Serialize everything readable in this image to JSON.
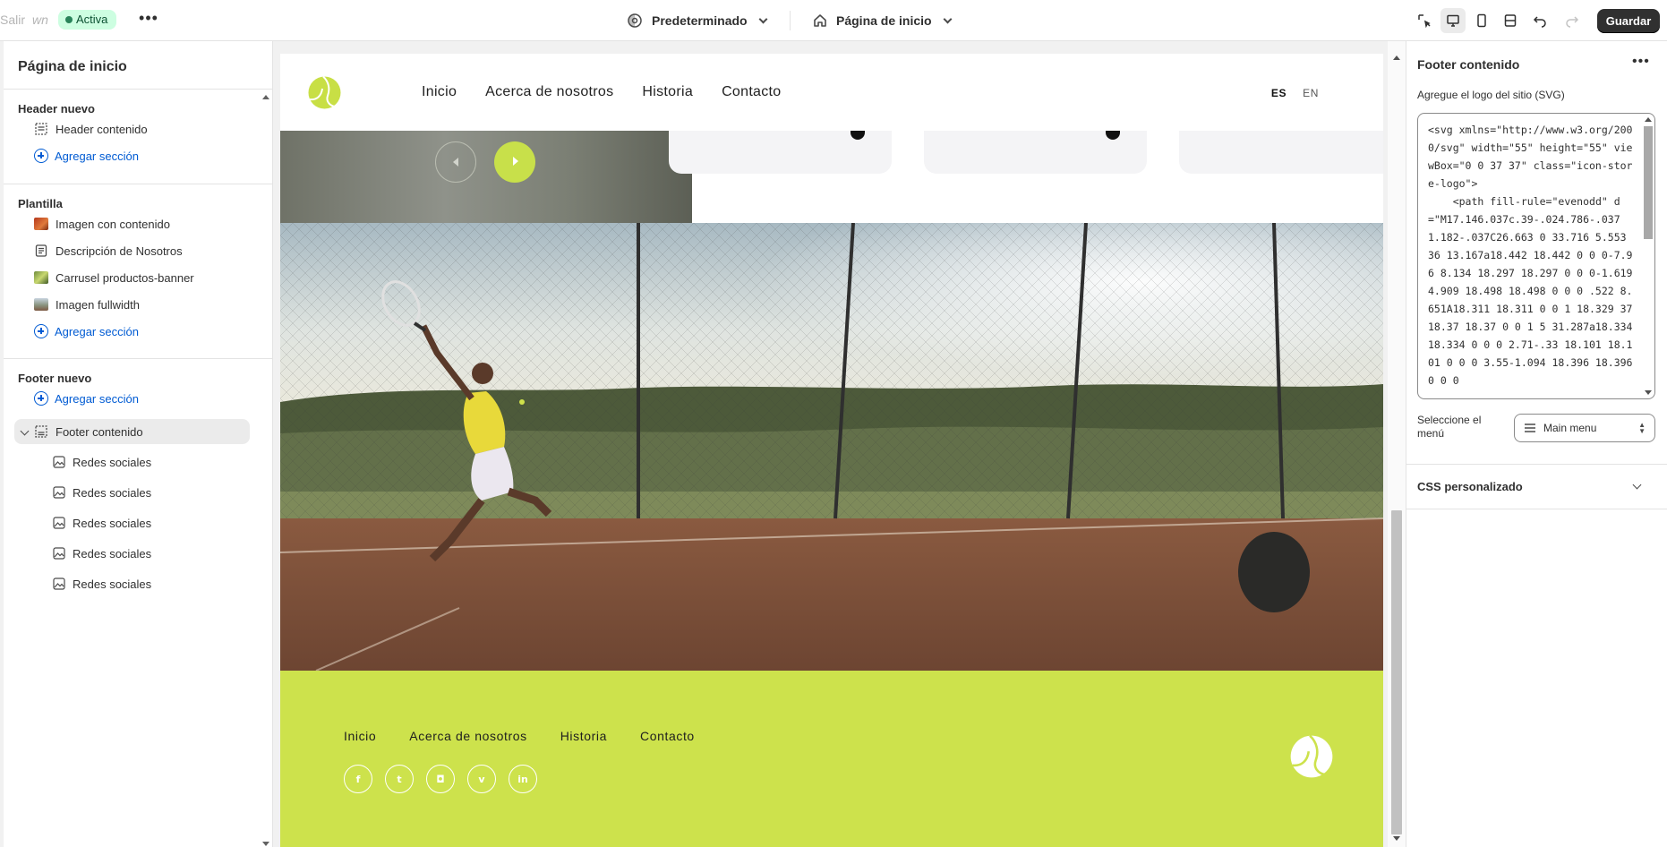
{
  "topbar": {
    "exit_label": "Salir",
    "store_name": "wn",
    "status_badge": "Activa",
    "theme_selector": "Predeterminado",
    "page_selector": "Página de inicio",
    "save_label": "Guardar"
  },
  "sidebar": {
    "title": "Página de inicio",
    "header_group": {
      "label": "Header nuevo",
      "items": [
        {
          "label": "Header contenido",
          "icon": "layout-icon"
        }
      ],
      "add_label": "Agregar sección"
    },
    "template_group": {
      "label": "Plantilla",
      "items": [
        {
          "label": "Imagen con contenido",
          "icon": "image-content-thumb"
        },
        {
          "label": "Descripción de Nosotros",
          "icon": "text-icon"
        },
        {
          "label": "Carrusel productos-banner",
          "icon": "carousel-thumb"
        },
        {
          "label": "Imagen fullwidth",
          "icon": "image-thumb"
        }
      ],
      "add_label": "Agregar sección"
    },
    "footer_group": {
      "label": "Footer nuevo",
      "add_label": "Agregar sección",
      "selected": {
        "label": "Footer contenido",
        "icon": "layout-icon"
      },
      "blocks": [
        {
          "label": "Redes sociales"
        },
        {
          "label": "Redes sociales"
        },
        {
          "label": "Redes sociales"
        },
        {
          "label": "Redes sociales"
        },
        {
          "label": "Redes sociales"
        }
      ]
    }
  },
  "preview": {
    "nav": [
      "Inicio",
      "Acerca de nosotros",
      "Historia",
      "Contacto"
    ],
    "languages": {
      "active": "ES",
      "other": "EN"
    },
    "footer_nav": [
      "Inicio",
      "Acerca de nosotros",
      "Historia",
      "Contacto"
    ],
    "social": [
      {
        "icon": "facebook-icon",
        "glyph": "f"
      },
      {
        "icon": "twitter-icon",
        "glyph": "t"
      },
      {
        "icon": "instagram-icon",
        "glyph": "◘"
      },
      {
        "icon": "vimeo-icon",
        "glyph": "v"
      },
      {
        "icon": "linkedin-icon",
        "glyph": "in"
      }
    ],
    "colors": {
      "brand_green": "#cde24c"
    }
  },
  "panel": {
    "title": "Footer contenido",
    "logo_label": "Agregue el logo del sitio (SVG)",
    "logo_code": "<svg xmlns=\"http://www.w3.org/2000/svg\" width=\"55\" height=\"55\" viewBox=\"0 0 37 37\" class=\"icon-store-logo\">\n    <path fill-rule=\"evenodd\" d=\"M17.146.037c.39-.024.786-.037 1.182-.037C26.663 0 33.716 5.553 36 13.167a18.442 18.442 0 0 0-7.96 8.134 18.297 18.297 0 0 0-1.619 4.909 18.498 18.498 0 0 0 .522 8.651A18.311 18.311 0 0 1 18.329 37 18.37 18.37 0 0 1 5 31.287a18.334 18.334 0 0 0 2.71-.33 18.101 18.101 0 0 0 3.55-1.094 18.396 18.396 0 0 0",
    "menu_label": "Seleccione el menú",
    "menu_value": "Main menu",
    "css_label": "CSS personalizado"
  }
}
